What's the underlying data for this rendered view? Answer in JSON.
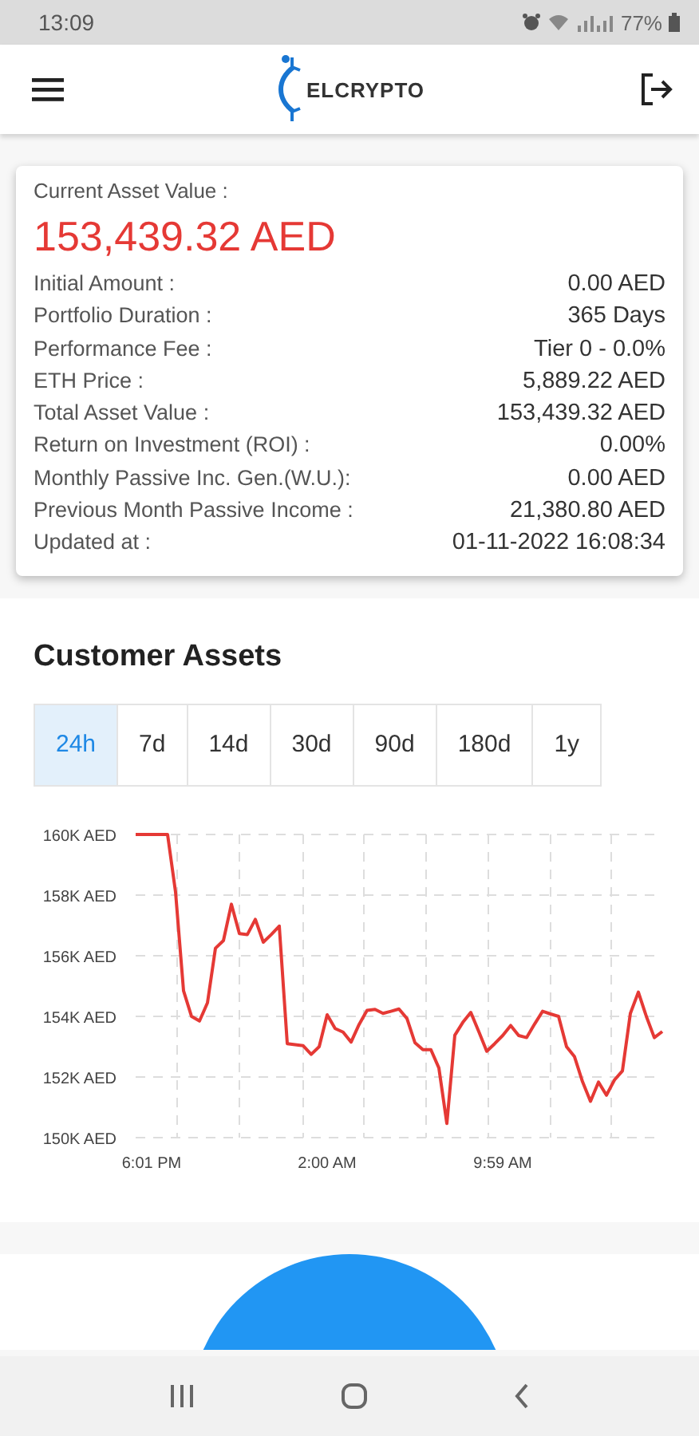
{
  "status_bar": {
    "time": "13:09",
    "battery": "77%"
  },
  "app_bar": {
    "logo": "ELCRYPTO"
  },
  "summary": {
    "title": "Current Asset Value :",
    "value": "153,439.32 AED",
    "rows": [
      {
        "label": "Initial Amount :",
        "value": "0.00 AED"
      },
      {
        "label": "Portfolio Duration :",
        "value": "365 Days"
      },
      {
        "label": "Performance Fee :",
        "value": "Tier 0 - 0.0%"
      },
      {
        "label": "ETH Price :",
        "value": "5,889.22 AED"
      },
      {
        "label": "Total Asset Value :",
        "value": "153,439.32 AED"
      },
      {
        "label": "Return on Investment (ROI) :",
        "value": "0.00%"
      },
      {
        "label": "Monthly Passive Inc. Gen.(W.U.):",
        "value": "0.00 AED"
      },
      {
        "label": "Previous Month Passive Income :",
        "value": "21,380.80 AED"
      },
      {
        "label": "Updated at :",
        "value": "01-11-2022 16:08:34"
      }
    ]
  },
  "assets": {
    "title": "Customer Assets",
    "ranges": [
      {
        "label": "24h",
        "selected": true
      },
      {
        "label": "7d",
        "selected": false
      },
      {
        "label": "14d",
        "selected": false
      },
      {
        "label": "30d",
        "selected": false
      },
      {
        "label": "90d",
        "selected": false
      },
      {
        "label": "180d",
        "selected": false
      },
      {
        "label": "1y",
        "selected": false
      }
    ],
    "chart_data": {
      "type": "line",
      "grid": true,
      "categories": [
        null,
        null,
        "6:01 PM",
        null,
        null,
        null,
        null,
        null,
        null,
        null,
        null,
        null,
        null,
        null,
        null,
        null,
        null,
        null,
        null,
        null,
        null,
        null,
        null,
        null,
        "2:00 AM",
        null,
        null,
        null,
        null,
        null,
        null,
        null,
        null,
        null,
        null,
        null,
        null,
        null,
        null,
        null,
        null,
        null,
        null,
        null,
        null,
        null,
        "9:59 AM",
        null,
        null,
        null,
        null,
        null,
        null,
        null,
        null,
        null,
        null,
        null,
        null,
        null,
        null,
        null,
        null,
        null,
        null,
        null,
        null
      ],
      "series": [
        {
          "color": "#e53935",
          "values": [
            160,
            160,
            160,
            160,
            160,
            158.1,
            154.85,
            154,
            153.85,
            154.45,
            156.25,
            156.5,
            157.7,
            156.73,
            156.7,
            157.2,
            156.45,
            156.7,
            156.98,
            153.1,
            153.07,
            153.03,
            152.75,
            153,
            154.05,
            153.6,
            153.48,
            153.15,
            153.73,
            154.2,
            154.23,
            154.1,
            154.17,
            154.24,
            153.93,
            153.13,
            152.9,
            152.9,
            152.3,
            150.47,
            153.38,
            153.8,
            154.13,
            153.5,
            152.85,
            153.1,
            153.37,
            153.7,
            153.37,
            153.3,
            153.75,
            154.17,
            154.08,
            154,
            153,
            152.67,
            151.85,
            151.2,
            151.83,
            151.4,
            151.9,
            152.2,
            154.1,
            154.8,
            154,
            153.3,
            153.5
          ]
        }
      ],
      "ylim": [
        150,
        160
      ],
      "yticks": [
        {
          "value": 160,
          "label": "160K AED"
        },
        {
          "value": 158,
          "label": "158K AED"
        },
        {
          "value": 156,
          "label": "156K AED"
        },
        {
          "value": 154,
          "label": "154K AED"
        },
        {
          "value": 152,
          "label": "152K AED"
        },
        {
          "value": 150,
          "label": "150K AED"
        }
      ]
    }
  }
}
